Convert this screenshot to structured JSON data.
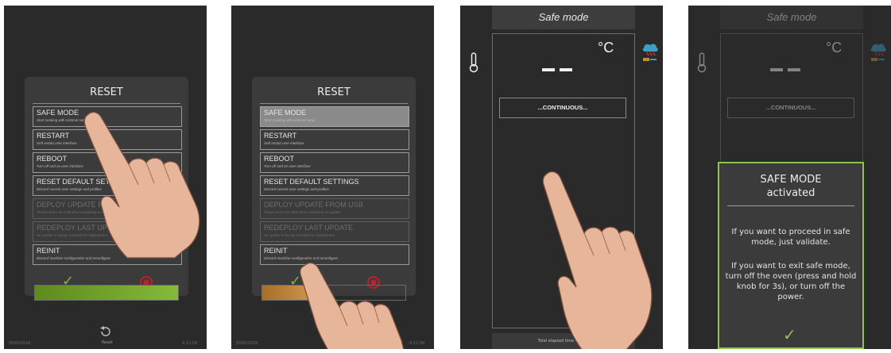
{
  "reset_dialog": {
    "title": "RESET",
    "options": [
      {
        "title": "SAFE MODE",
        "subtitle": "Start cooking with minimal setup",
        "enabled": true
      },
      {
        "title": "RESTART",
        "subtitle": "Soft restart user interface",
        "enabled": true
      },
      {
        "title": "REBOOT",
        "subtitle": "Turn off and on user interface",
        "enabled": true
      },
      {
        "title": "RESET DEFAULT SETTINGS",
        "subtitle": "Discard current user settings and profiles",
        "enabled": true
      },
      {
        "title": "DEPLOY UPDATE FROM USB",
        "subtitle": "Please insert an USB drive containing an update",
        "enabled": false
      },
      {
        "title": "REDEPLOY LAST UPDATE",
        "subtitle": "No update is locally available for deployment",
        "enabled": false
      },
      {
        "title": "REINIT",
        "subtitle": "Discard machine configuration and reconfigure",
        "enabled": true
      }
    ],
    "validate_icon": "check-icon",
    "cancel_icon": "cancel-icon"
  },
  "panel1": {
    "progress_fraction": 1.0,
    "progress_color": "#7aab2e",
    "bottom_left": "5000/2018",
    "bottom_right": "4.12.09",
    "restart_label": "Reset"
  },
  "panel2": {
    "progress_fraction": 0.32,
    "progress_color": "#c28a36",
    "bottom_left": "5000/2018",
    "bottom_right": "4.12.09"
  },
  "cooking_screen": {
    "mode": "Safe mode",
    "unit": "°C",
    "temperature": "– –",
    "continuous_label": "...CONTINUOUS...",
    "elapsed": "Total elapsed time : 00:00"
  },
  "safe_mode_dialog": {
    "title_line1": "SAFE MODE",
    "title_line2": "activated",
    "paragraph1": "If you want to proceed in safe mode, just validate.",
    "paragraph2": "If you want to exit safe mode, turn off the oven (press and hold knob for 3s), or turn off the power.",
    "validate_icon": "check-icon"
  },
  "colors": {
    "accent_green": "#8cc54a",
    "cancel_red": "#c0202a",
    "panel_bg": "#2a2a2a"
  }
}
